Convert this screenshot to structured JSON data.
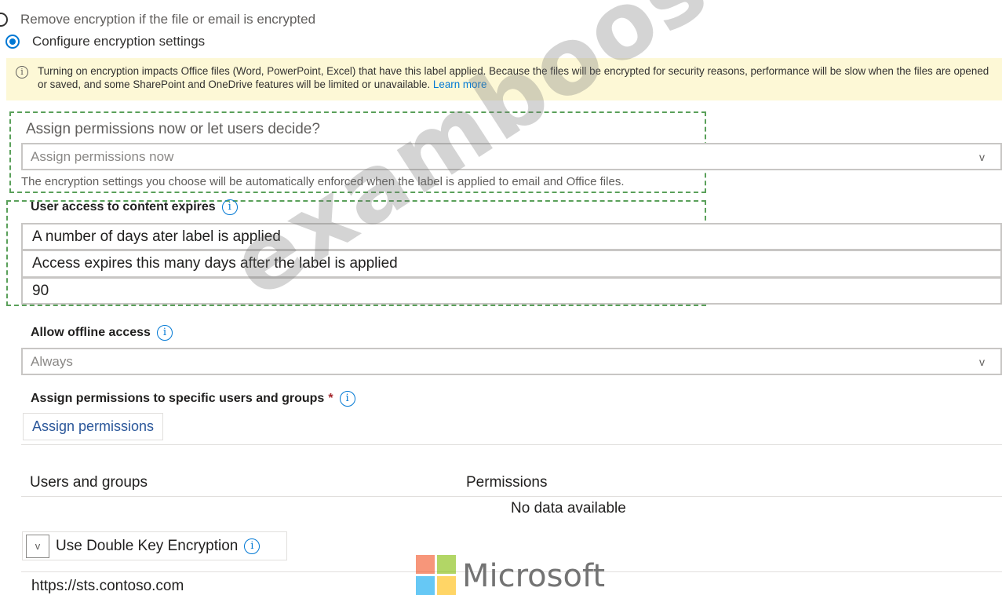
{
  "encryption_options": {
    "remove_label": "Remove encryption if the file or email is encrypted",
    "configure_label": "Configure encryption settings",
    "selected": "configure"
  },
  "info_banner": {
    "text": "Turning on encryption impacts Office files (Word, PowerPoint, Excel) that have this label applied. Because the files will be encrypted for security reasons, performance will be slow when the files are opened or saved, and some SharePoint and OneDrive features will be limited or unavailable.",
    "link": "Learn more"
  },
  "assign_section": {
    "question": "Assign permissions now or let users decide?",
    "selected_value": "Assign permissions now",
    "helper": "The encryption settings you choose will be automatically enforced when the label is applied to email and Office files."
  },
  "expiry_section": {
    "label": "User access to content expires",
    "option_value": "A number of days ater label is applied",
    "description": "Access expires this many days after the label is applied",
    "days": "90"
  },
  "offline_section": {
    "label": "Allow offline access",
    "value": "Always"
  },
  "permissions_section": {
    "label": "Assign permissions to specific users and groups",
    "required_mark": "*",
    "button": "Assign permissions",
    "col_users": "Users and groups",
    "col_permissions": "Permissions",
    "empty": "No data available"
  },
  "dke_section": {
    "toggle_glyph": "v",
    "label": "Use Double Key Encryption",
    "url": "https://sts.contoso.com"
  },
  "icons": {
    "info": "i",
    "chevron": "v"
  },
  "watermark": {
    "text": "examboosts.com"
  },
  "logo": {
    "text": "Microsoft",
    "colors": [
      "#f25022",
      "#7fba00",
      "#00a4ef",
      "#ffb900"
    ]
  }
}
